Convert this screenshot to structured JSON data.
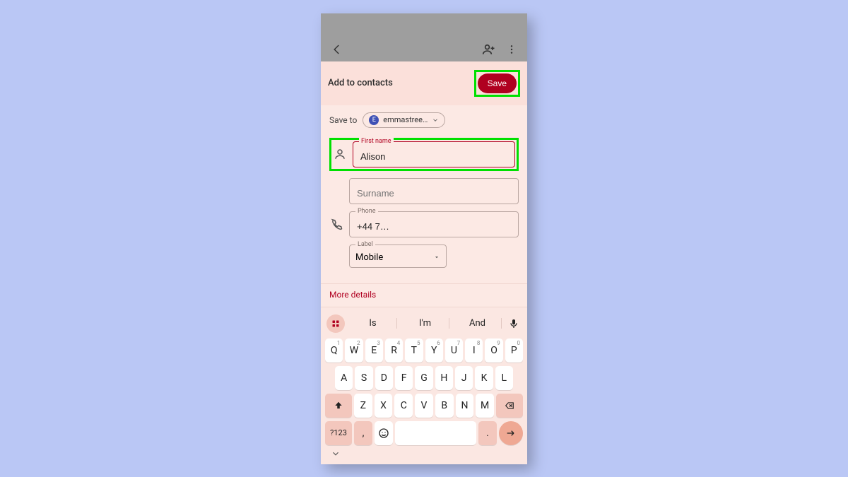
{
  "header": {
    "title": "Add to contacts",
    "save": "Save"
  },
  "save_to": {
    "label": "Save to",
    "account": "emmastree…",
    "avatar_letter": "E"
  },
  "fields": {
    "first_name": {
      "label": "First name",
      "value": "Alison"
    },
    "surname": {
      "label": "Surname",
      "value": ""
    },
    "phone": {
      "label": "Phone",
      "value": "+44 7…"
    },
    "label_sel": {
      "label": "Label",
      "value": "Mobile"
    }
  },
  "more_details": "More details",
  "suggestions": {
    "a": "Is",
    "b": "I'm",
    "c": "And"
  },
  "keyboard": {
    "row1": [
      "Q",
      "W",
      "E",
      "R",
      "T",
      "Y",
      "U",
      "I",
      "O",
      "P"
    ],
    "row1n": [
      "1",
      "2",
      "3",
      "4",
      "5",
      "6",
      "7",
      "8",
      "9",
      "0"
    ],
    "row2": [
      "A",
      "S",
      "D",
      "F",
      "G",
      "H",
      "J",
      "K",
      "L"
    ],
    "row3": [
      "Z",
      "X",
      "C",
      "V",
      "B",
      "N",
      "M"
    ],
    "sym": "?123",
    "comma": ",",
    "period": "."
  }
}
